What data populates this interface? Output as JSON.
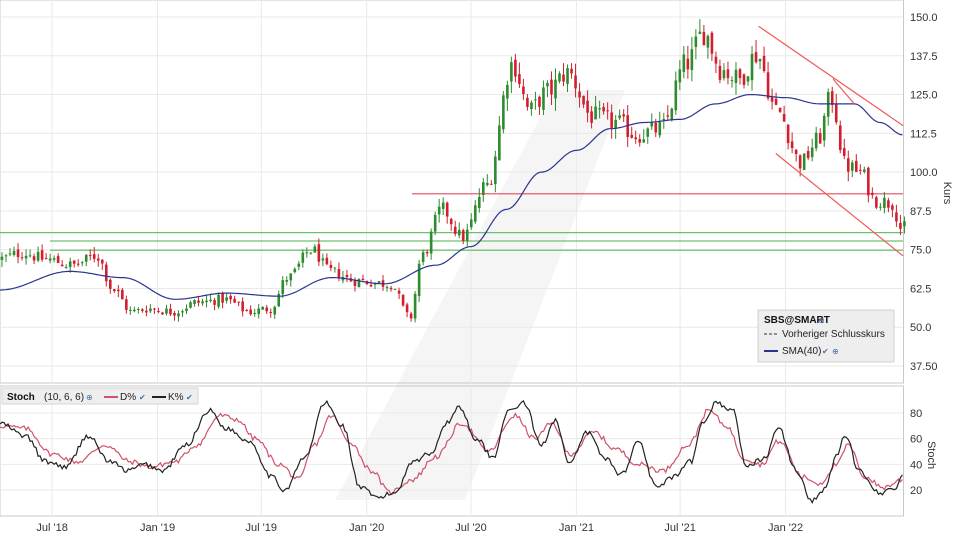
{
  "chart_data": [
    {
      "type": "candlestick",
      "title": "",
      "ylabel": "Kurs",
      "ylim": [
        30,
        152
      ],
      "y_ticks": [
        "150.0",
        "137.5",
        "125.0",
        "112.5",
        "100.0",
        "87.5",
        "75.0",
        "62.5",
        "50.0",
        "37.50"
      ],
      "y_tick_values": [
        150,
        137.5,
        125,
        112.5,
        100,
        87.5,
        75,
        62.5,
        50,
        37.5
      ],
      "x_range": [
        "2018-04-01",
        "2022-07-25"
      ],
      "x_ticks": [
        {
          "date": "2018-07-01",
          "label": "Jul '18"
        },
        {
          "date": "2019-01-01",
          "label": "Jan '19"
        },
        {
          "date": "2019-07-01",
          "label": "Jul '19"
        },
        {
          "date": "2020-01-01",
          "label": "Jan '20"
        },
        {
          "date": "2020-07-01",
          "label": "Jul '20"
        },
        {
          "date": "2021-01-01",
          "label": "Jan '21"
        },
        {
          "date": "2021-07-01",
          "label": "Jul '21"
        },
        {
          "date": "2022-01-01",
          "label": "Jan '22"
        }
      ],
      "close_anchors": [
        [
          "2018-04-01",
          72
        ],
        [
          "2018-05-15",
          74
        ],
        [
          "2018-06-20",
          72
        ],
        [
          "2018-08-10",
          70
        ],
        [
          "2018-09-20",
          73
        ],
        [
          "2018-10-20",
          62
        ],
        [
          "2018-11-20",
          55
        ],
        [
          "2018-12-20",
          56
        ],
        [
          "2019-02-01",
          55
        ],
        [
          "2019-03-15",
          58
        ],
        [
          "2019-05-01",
          59
        ],
        [
          "2019-06-15",
          55
        ],
        [
          "2019-07-20",
          56
        ],
        [
          "2019-08-20",
          66
        ],
        [
          "2019-10-01",
          75
        ],
        [
          "2019-11-01",
          68
        ],
        [
          "2019-12-15",
          65
        ],
        [
          "2020-02-15",
          64
        ],
        [
          "2020-03-20",
          53
        ],
        [
          "2020-04-10",
          73
        ],
        [
          "2020-05-15",
          88
        ],
        [
          "2020-06-20",
          79
        ],
        [
          "2020-08-01",
          96
        ],
        [
          "2020-09-15",
          135
        ],
        [
          "2020-10-15",
          120
        ],
        [
          "2020-11-15",
          126
        ],
        [
          "2020-12-20",
          132
        ],
        [
          "2021-02-01",
          118
        ],
        [
          "2021-03-15",
          116
        ],
        [
          "2021-04-20",
          112
        ],
        [
          "2021-06-01",
          114
        ],
        [
          "2021-07-15",
          135
        ],
        [
          "2021-08-15",
          145
        ],
        [
          "2021-09-15",
          133
        ],
        [
          "2021-10-15",
          130
        ],
        [
          "2021-11-15",
          138
        ],
        [
          "2021-12-20",
          120
        ],
        [
          "2022-02-01",
          103
        ],
        [
          "2022-03-01",
          110
        ],
        [
          "2022-03-25",
          124
        ],
        [
          "2022-04-20",
          102
        ],
        [
          "2022-05-15",
          100
        ],
        [
          "2022-06-10",
          91
        ],
        [
          "2022-07-10",
          90
        ],
        [
          "2022-07-25",
          82
        ]
      ],
      "sma40_anchors": [
        [
          "2018-04-01",
          62
        ],
        [
          "2018-08-01",
          68
        ],
        [
          "2018-11-01",
          66
        ],
        [
          "2019-02-01",
          59
        ],
        [
          "2019-05-01",
          61
        ],
        [
          "2019-08-01",
          60
        ],
        [
          "2019-11-01",
          66
        ],
        [
          "2020-02-01",
          64
        ],
        [
          "2020-05-01",
          70
        ],
        [
          "2020-07-01",
          76
        ],
        [
          "2020-09-01",
          88
        ],
        [
          "2020-11-01",
          100
        ],
        [
          "2021-01-01",
          107
        ],
        [
          "2021-03-01",
          114
        ],
        [
          "2021-05-01",
          116
        ],
        [
          "2021-07-01",
          117
        ],
        [
          "2021-09-01",
          122
        ],
        [
          "2021-11-01",
          125
        ],
        [
          "2022-01-01",
          124
        ],
        [
          "2022-03-01",
          122
        ],
        [
          "2022-05-01",
          122
        ],
        [
          "2022-06-15",
          116
        ],
        [
          "2022-07-25",
          112
        ]
      ],
      "horizontal_lines": {
        "red": [
          93
        ],
        "green": [
          80.5,
          77.8,
          74.8
        ]
      },
      "channel_lines": [
        {
          "from": [
            "2021-11-15",
            147
          ],
          "to": [
            "2022-07-25",
            115
          ]
        },
        {
          "from": [
            "2021-12-15",
            106
          ],
          "to": [
            "2022-07-25",
            73
          ]
        },
        {
          "from": [
            "2022-03-25",
            130
          ],
          "to": [
            "2022-05-01",
            122
          ]
        }
      ],
      "legend": {
        "symbol": "SBS@SMART",
        "items": [
          "Vorheriger Schlusskurs",
          "SMA(40)"
        ]
      },
      "colors": {
        "up": "#2e8b2e",
        "down": "#d21f2f",
        "sma": "#2a3590",
        "hline_red": "#e04b5a",
        "hline_green": "#6cc26c",
        "channel": "#f05a5a"
      }
    },
    {
      "type": "line",
      "title": "Stoch",
      "params": "(10, 6, 6)",
      "ylabel": "Stoch",
      "ylim": [
        0,
        100
      ],
      "y_ticks": [
        "80",
        "60",
        "40",
        "20"
      ],
      "y_tick_values": [
        80,
        60,
        40,
        20
      ],
      "series": [
        {
          "name": "D%",
          "color": "#d0526a",
          "anchors": [
            [
              "2018-04-01",
              70
            ],
            [
              "2018-05-15",
              68
            ],
            [
              "2018-07-01",
              48
            ],
            [
              "2018-08-15",
              42
            ],
            [
              "2018-10-01",
              55
            ],
            [
              "2018-11-15",
              42
            ],
            [
              "2018-12-20",
              38
            ],
            [
              "2019-02-01",
              42
            ],
            [
              "2019-03-10",
              55
            ],
            [
              "2019-04-20",
              78
            ],
            [
              "2019-05-20",
              75
            ],
            [
              "2019-06-20",
              60
            ],
            [
              "2019-08-01",
              40
            ],
            [
              "2019-09-05",
              28
            ],
            [
              "2019-10-01",
              55
            ],
            [
              "2019-11-01",
              78
            ],
            [
              "2019-12-01",
              58
            ],
            [
              "2020-01-10",
              35
            ],
            [
              "2020-02-10",
              18
            ],
            [
              "2020-03-20",
              28
            ],
            [
              "2020-05-01",
              46
            ],
            [
              "2020-06-15",
              72
            ],
            [
              "2020-08-01",
              50
            ],
            [
              "2020-09-15",
              78
            ],
            [
              "2020-10-20",
              60
            ],
            [
              "2020-11-20",
              72
            ],
            [
              "2020-12-20",
              48
            ],
            [
              "2021-02-01",
              65
            ],
            [
              "2021-03-10",
              52
            ],
            [
              "2021-04-20",
              40
            ],
            [
              "2021-06-01",
              35
            ],
            [
              "2021-07-15",
              55
            ],
            [
              "2021-08-20",
              82
            ],
            [
              "2021-09-20",
              70
            ],
            [
              "2021-10-20",
              45
            ],
            [
              "2021-11-20",
              40
            ],
            [
              "2021-12-20",
              58
            ],
            [
              "2022-02-01",
              30
            ],
            [
              "2022-03-01",
              25
            ],
            [
              "2022-04-01",
              40
            ],
            [
              "2022-04-20",
              55
            ],
            [
              "2022-05-20",
              30
            ],
            [
              "2022-06-20",
              22
            ],
            [
              "2022-07-25",
              28
            ]
          ]
        },
        {
          "name": "K%",
          "color": "#222222",
          "anchors": [
            [
              "2018-04-01",
              72
            ],
            [
              "2018-05-15",
              62
            ],
            [
              "2018-06-20",
              42
            ],
            [
              "2018-07-25",
              38
            ],
            [
              "2018-09-01",
              62
            ],
            [
              "2018-10-10",
              42
            ],
            [
              "2018-11-10",
              35
            ],
            [
              "2018-12-10",
              40
            ],
            [
              "2019-01-10",
              35
            ],
            [
              "2019-02-20",
              55
            ],
            [
              "2019-04-01",
              82
            ],
            [
              "2019-05-01",
              68
            ],
            [
              "2019-06-10",
              58
            ],
            [
              "2019-07-20",
              30
            ],
            [
              "2019-08-10",
              20
            ],
            [
              "2019-09-15",
              45
            ],
            [
              "2019-10-20",
              88
            ],
            [
              "2019-11-20",
              70
            ],
            [
              "2019-12-20",
              22
            ],
            [
              "2020-01-20",
              14
            ],
            [
              "2020-02-20",
              18
            ],
            [
              "2020-03-20",
              42
            ],
            [
              "2020-04-20",
              48
            ],
            [
              "2020-05-20",
              72
            ],
            [
              "2020-06-10",
              85
            ],
            [
              "2020-07-10",
              60
            ],
            [
              "2020-08-10",
              45
            ],
            [
              "2020-09-01",
              80
            ],
            [
              "2020-10-01",
              88
            ],
            [
              "2020-11-01",
              55
            ],
            [
              "2020-11-25",
              75
            ],
            [
              "2020-12-20",
              40
            ],
            [
              "2021-01-20",
              65
            ],
            [
              "2021-02-20",
              45
            ],
            [
              "2021-03-20",
              32
            ],
            [
              "2021-04-20",
              58
            ],
            [
              "2021-05-20",
              22
            ],
            [
              "2021-06-20",
              30
            ],
            [
              "2021-07-20",
              42
            ],
            [
              "2021-08-10",
              72
            ],
            [
              "2021-09-01",
              88
            ],
            [
              "2021-10-01",
              82
            ],
            [
              "2021-10-25",
              38
            ],
            [
              "2021-11-25",
              45
            ],
            [
              "2021-12-20",
              68
            ],
            [
              "2022-01-20",
              35
            ],
            [
              "2022-02-15",
              12
            ],
            [
              "2022-03-10",
              20
            ],
            [
              "2022-04-01",
              48
            ],
            [
              "2022-04-15",
              62
            ],
            [
              "2022-05-10",
              35
            ],
            [
              "2022-06-15",
              18
            ],
            [
              "2022-07-10",
              20
            ],
            [
              "2022-07-25",
              32
            ]
          ]
        }
      ]
    }
  ]
}
